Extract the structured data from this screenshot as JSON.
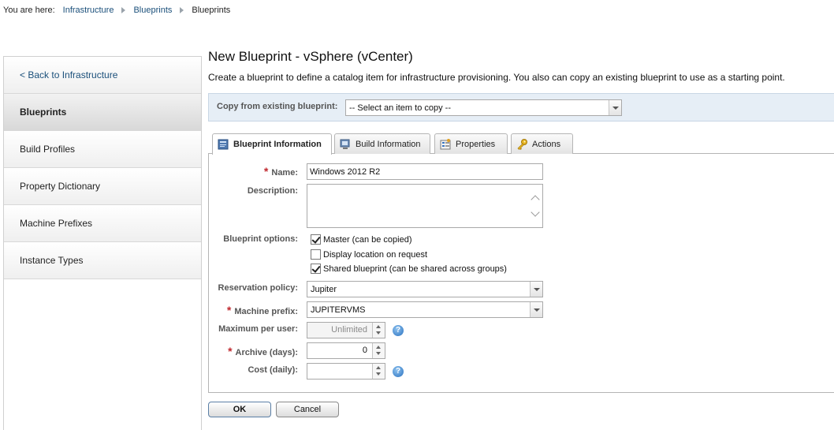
{
  "breadcrumb": {
    "label": "You are here:",
    "items": [
      "Infrastructure",
      "Blueprints",
      "Blueprints"
    ]
  },
  "sidebar": {
    "items": [
      {
        "label": "< Back to Infrastructure"
      },
      {
        "label": "Blueprints"
      },
      {
        "label": "Build Profiles"
      },
      {
        "label": "Property Dictionary"
      },
      {
        "label": "Machine Prefixes"
      },
      {
        "label": "Instance Types"
      }
    ]
  },
  "page": {
    "title": "New Blueprint - vSphere (vCenter)",
    "description": "Create a blueprint to define a catalog item for infrastructure provisioning. You also can copy an existing blueprint to use as a starting point."
  },
  "copy": {
    "label": "Copy from existing blueprint:",
    "selected": "-- Select an item to copy --"
  },
  "tabs": [
    {
      "label": "Blueprint Information",
      "icon": "blueprint-icon",
      "active": true
    },
    {
      "label": "Build Information",
      "icon": "monitor-icon",
      "active": false
    },
    {
      "label": "Properties",
      "icon": "properties-icon",
      "active": false
    },
    {
      "label": "Actions",
      "icon": "key-icon",
      "active": false
    }
  ],
  "form": {
    "name_label": "Name:",
    "name_value": "Windows 2012 R2",
    "description_label": "Description:",
    "description_value": "",
    "options_label": "Blueprint options:",
    "options": [
      {
        "label": "Master (can be copied)",
        "checked": true
      },
      {
        "label": "Display location on request",
        "checked": false
      },
      {
        "label": "Shared blueprint (can be shared across groups)",
        "checked": true
      }
    ],
    "reservation_label": "Reservation policy:",
    "reservation_value": "Jupiter",
    "prefix_label": "Machine prefix:",
    "prefix_value": "JUPITERVMS",
    "max_label": "Maximum per user:",
    "max_value": "Unlimited",
    "archive_label": "Archive (days):",
    "archive_value": "0",
    "cost_label": "Cost (daily):",
    "cost_value": ""
  },
  "buttons": {
    "ok": "OK",
    "cancel": "Cancel"
  },
  "colors": {
    "link": "#1a4f7a",
    "required": "#c0282e",
    "copy_bar": "#e6eef6"
  }
}
